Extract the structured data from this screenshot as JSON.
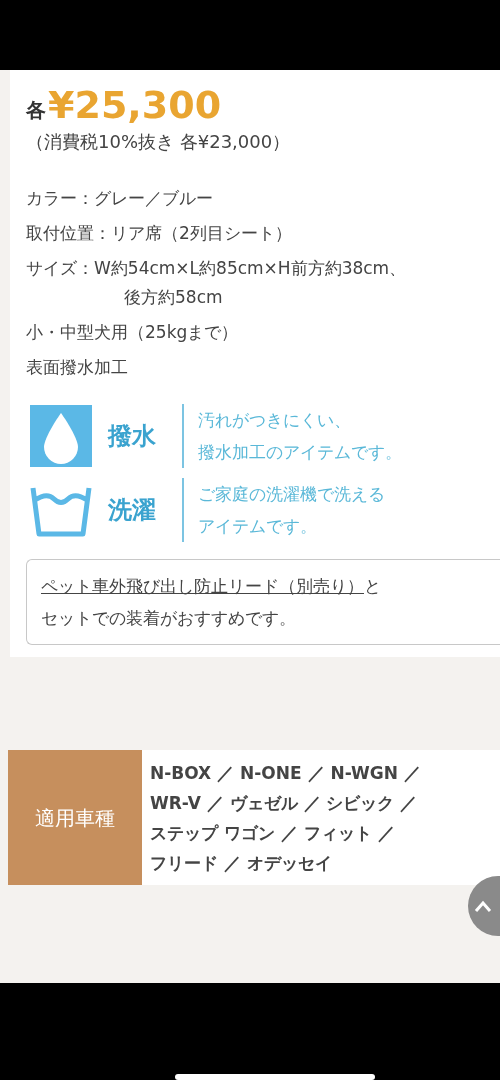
{
  "price": {
    "prefix": "各",
    "amount": "¥25,300",
    "tax_note": "（消費税10%抜き 各¥23,000）"
  },
  "specs": [
    {
      "kind": "line",
      "text": "カラー：グレー／ブルー"
    },
    {
      "kind": "line",
      "text": "取付位置：リア席（2列目シート）"
    },
    {
      "kind": "line",
      "text": "サイズ：W約54cm×L約85cm×H前方約38cm、"
    },
    {
      "kind": "continuation",
      "text": "後方約58cm"
    },
    {
      "kind": "line",
      "text": "小・中型犬用（25kgまで）"
    },
    {
      "kind": "line",
      "text": "表面撥水加工"
    }
  ],
  "features": [
    {
      "kind": "water-drop",
      "label": "撥水",
      "description": [
        "汚れがつきにくい、",
        "撥水加工のアイテムです。"
      ]
    },
    {
      "kind": "washing",
      "label": "洗濯",
      "description": [
        "ご家庭の洗濯機で洗える",
        "アイテムです。"
      ]
    }
  ],
  "note": {
    "link": "ペット車外飛び出し防止リード（別売り）",
    "text_after_link": "と",
    "second_line": "セットでの装着がおすすめです。"
  },
  "vehicles": {
    "label": "適用車種",
    "lines": [
      "N-BOX ／ N-ONE ／ N-WGN ／",
      "WR-V ／ ヴェゼル ／ シビック ／",
      "ステップ ワゴン ／ フィット ／",
      "フリード ／ オデッセイ"
    ]
  }
}
